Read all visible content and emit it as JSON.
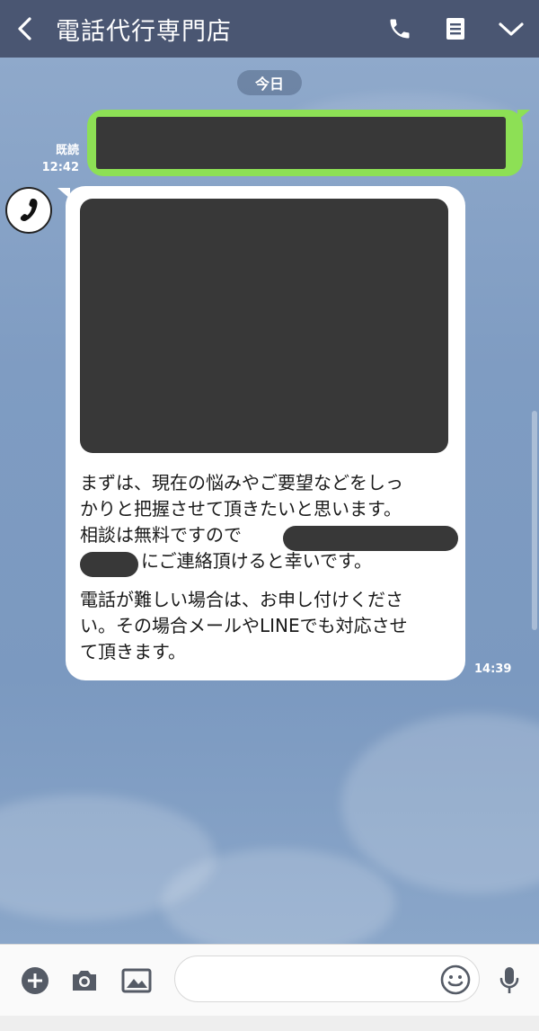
{
  "header": {
    "title": "電話代行専門店",
    "back_icon": "chevron-left-icon",
    "icons": [
      "phone-icon",
      "notes-icon",
      "chevron-down-icon"
    ]
  },
  "chat": {
    "date_label": "今日",
    "sent": {
      "read_label": "既読",
      "time": "12:42"
    },
    "received": {
      "avatar_icon": "phone-handset-icon",
      "paragraph1": [
        "まずは、現在の悩みやご要望などをしっ",
        "かりと把握させて頂きたいと思います。",
        "相談は無料ですので",
        "にご連絡頂けると幸いです。"
      ],
      "paragraph2": [
        "電話が難しい場合は、お申し付けくださ",
        "い。その場合メールやLINEでも対応させ",
        "て頂きます。"
      ],
      "time": "14:39"
    }
  },
  "input_bar": {
    "icons": [
      "plus-circle-icon",
      "camera-icon",
      "image-icon",
      "smiley-icon",
      "microphone-icon"
    ],
    "placeholder": ""
  },
  "colors": {
    "header_bg": "#4a5672",
    "chat_bg": "#7f9bc0",
    "sent_bubble": "#8de055",
    "received_bubble": "#ffffff",
    "redaction": "#383838"
  }
}
